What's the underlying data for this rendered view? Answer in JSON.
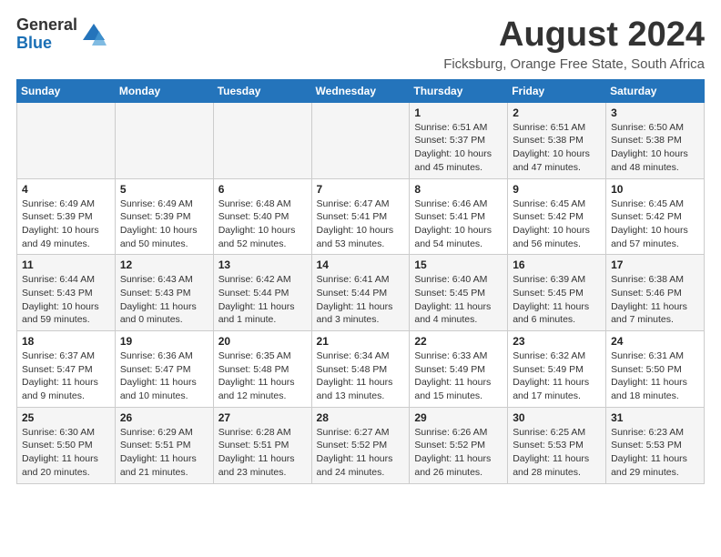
{
  "logo": {
    "general": "General",
    "blue": "Blue"
  },
  "title": "August 2024",
  "subtitle": "Ficksburg, Orange Free State, South Africa",
  "weekdays": [
    "Sunday",
    "Monday",
    "Tuesday",
    "Wednesday",
    "Thursday",
    "Friday",
    "Saturday"
  ],
  "weeks": [
    [
      {
        "day": "",
        "info": ""
      },
      {
        "day": "",
        "info": ""
      },
      {
        "day": "",
        "info": ""
      },
      {
        "day": "",
        "info": ""
      },
      {
        "day": "1",
        "info": "Sunrise: 6:51 AM\nSunset: 5:37 PM\nDaylight: 10 hours\nand 45 minutes."
      },
      {
        "day": "2",
        "info": "Sunrise: 6:51 AM\nSunset: 5:38 PM\nDaylight: 10 hours\nand 47 minutes."
      },
      {
        "day": "3",
        "info": "Sunrise: 6:50 AM\nSunset: 5:38 PM\nDaylight: 10 hours\nand 48 minutes."
      }
    ],
    [
      {
        "day": "4",
        "info": "Sunrise: 6:49 AM\nSunset: 5:39 PM\nDaylight: 10 hours\nand 49 minutes."
      },
      {
        "day": "5",
        "info": "Sunrise: 6:49 AM\nSunset: 5:39 PM\nDaylight: 10 hours\nand 50 minutes."
      },
      {
        "day": "6",
        "info": "Sunrise: 6:48 AM\nSunset: 5:40 PM\nDaylight: 10 hours\nand 52 minutes."
      },
      {
        "day": "7",
        "info": "Sunrise: 6:47 AM\nSunset: 5:41 PM\nDaylight: 10 hours\nand 53 minutes."
      },
      {
        "day": "8",
        "info": "Sunrise: 6:46 AM\nSunset: 5:41 PM\nDaylight: 10 hours\nand 54 minutes."
      },
      {
        "day": "9",
        "info": "Sunrise: 6:45 AM\nSunset: 5:42 PM\nDaylight: 10 hours\nand 56 minutes."
      },
      {
        "day": "10",
        "info": "Sunrise: 6:45 AM\nSunset: 5:42 PM\nDaylight: 10 hours\nand 57 minutes."
      }
    ],
    [
      {
        "day": "11",
        "info": "Sunrise: 6:44 AM\nSunset: 5:43 PM\nDaylight: 10 hours\nand 59 minutes."
      },
      {
        "day": "12",
        "info": "Sunrise: 6:43 AM\nSunset: 5:43 PM\nDaylight: 11 hours\nand 0 minutes."
      },
      {
        "day": "13",
        "info": "Sunrise: 6:42 AM\nSunset: 5:44 PM\nDaylight: 11 hours\nand 1 minute."
      },
      {
        "day": "14",
        "info": "Sunrise: 6:41 AM\nSunset: 5:44 PM\nDaylight: 11 hours\nand 3 minutes."
      },
      {
        "day": "15",
        "info": "Sunrise: 6:40 AM\nSunset: 5:45 PM\nDaylight: 11 hours\nand 4 minutes."
      },
      {
        "day": "16",
        "info": "Sunrise: 6:39 AM\nSunset: 5:45 PM\nDaylight: 11 hours\nand 6 minutes."
      },
      {
        "day": "17",
        "info": "Sunrise: 6:38 AM\nSunset: 5:46 PM\nDaylight: 11 hours\nand 7 minutes."
      }
    ],
    [
      {
        "day": "18",
        "info": "Sunrise: 6:37 AM\nSunset: 5:47 PM\nDaylight: 11 hours\nand 9 minutes."
      },
      {
        "day": "19",
        "info": "Sunrise: 6:36 AM\nSunset: 5:47 PM\nDaylight: 11 hours\nand 10 minutes."
      },
      {
        "day": "20",
        "info": "Sunrise: 6:35 AM\nSunset: 5:48 PM\nDaylight: 11 hours\nand 12 minutes."
      },
      {
        "day": "21",
        "info": "Sunrise: 6:34 AM\nSunset: 5:48 PM\nDaylight: 11 hours\nand 13 minutes."
      },
      {
        "day": "22",
        "info": "Sunrise: 6:33 AM\nSunset: 5:49 PM\nDaylight: 11 hours\nand 15 minutes."
      },
      {
        "day": "23",
        "info": "Sunrise: 6:32 AM\nSunset: 5:49 PM\nDaylight: 11 hours\nand 17 minutes."
      },
      {
        "day": "24",
        "info": "Sunrise: 6:31 AM\nSunset: 5:50 PM\nDaylight: 11 hours\nand 18 minutes."
      }
    ],
    [
      {
        "day": "25",
        "info": "Sunrise: 6:30 AM\nSunset: 5:50 PM\nDaylight: 11 hours\nand 20 minutes."
      },
      {
        "day": "26",
        "info": "Sunrise: 6:29 AM\nSunset: 5:51 PM\nDaylight: 11 hours\nand 21 minutes."
      },
      {
        "day": "27",
        "info": "Sunrise: 6:28 AM\nSunset: 5:51 PM\nDaylight: 11 hours\nand 23 minutes."
      },
      {
        "day": "28",
        "info": "Sunrise: 6:27 AM\nSunset: 5:52 PM\nDaylight: 11 hours\nand 24 minutes."
      },
      {
        "day": "29",
        "info": "Sunrise: 6:26 AM\nSunset: 5:52 PM\nDaylight: 11 hours\nand 26 minutes."
      },
      {
        "day": "30",
        "info": "Sunrise: 6:25 AM\nSunset: 5:53 PM\nDaylight: 11 hours\nand 28 minutes."
      },
      {
        "day": "31",
        "info": "Sunrise: 6:23 AM\nSunset: 5:53 PM\nDaylight: 11 hours\nand 29 minutes."
      }
    ]
  ]
}
